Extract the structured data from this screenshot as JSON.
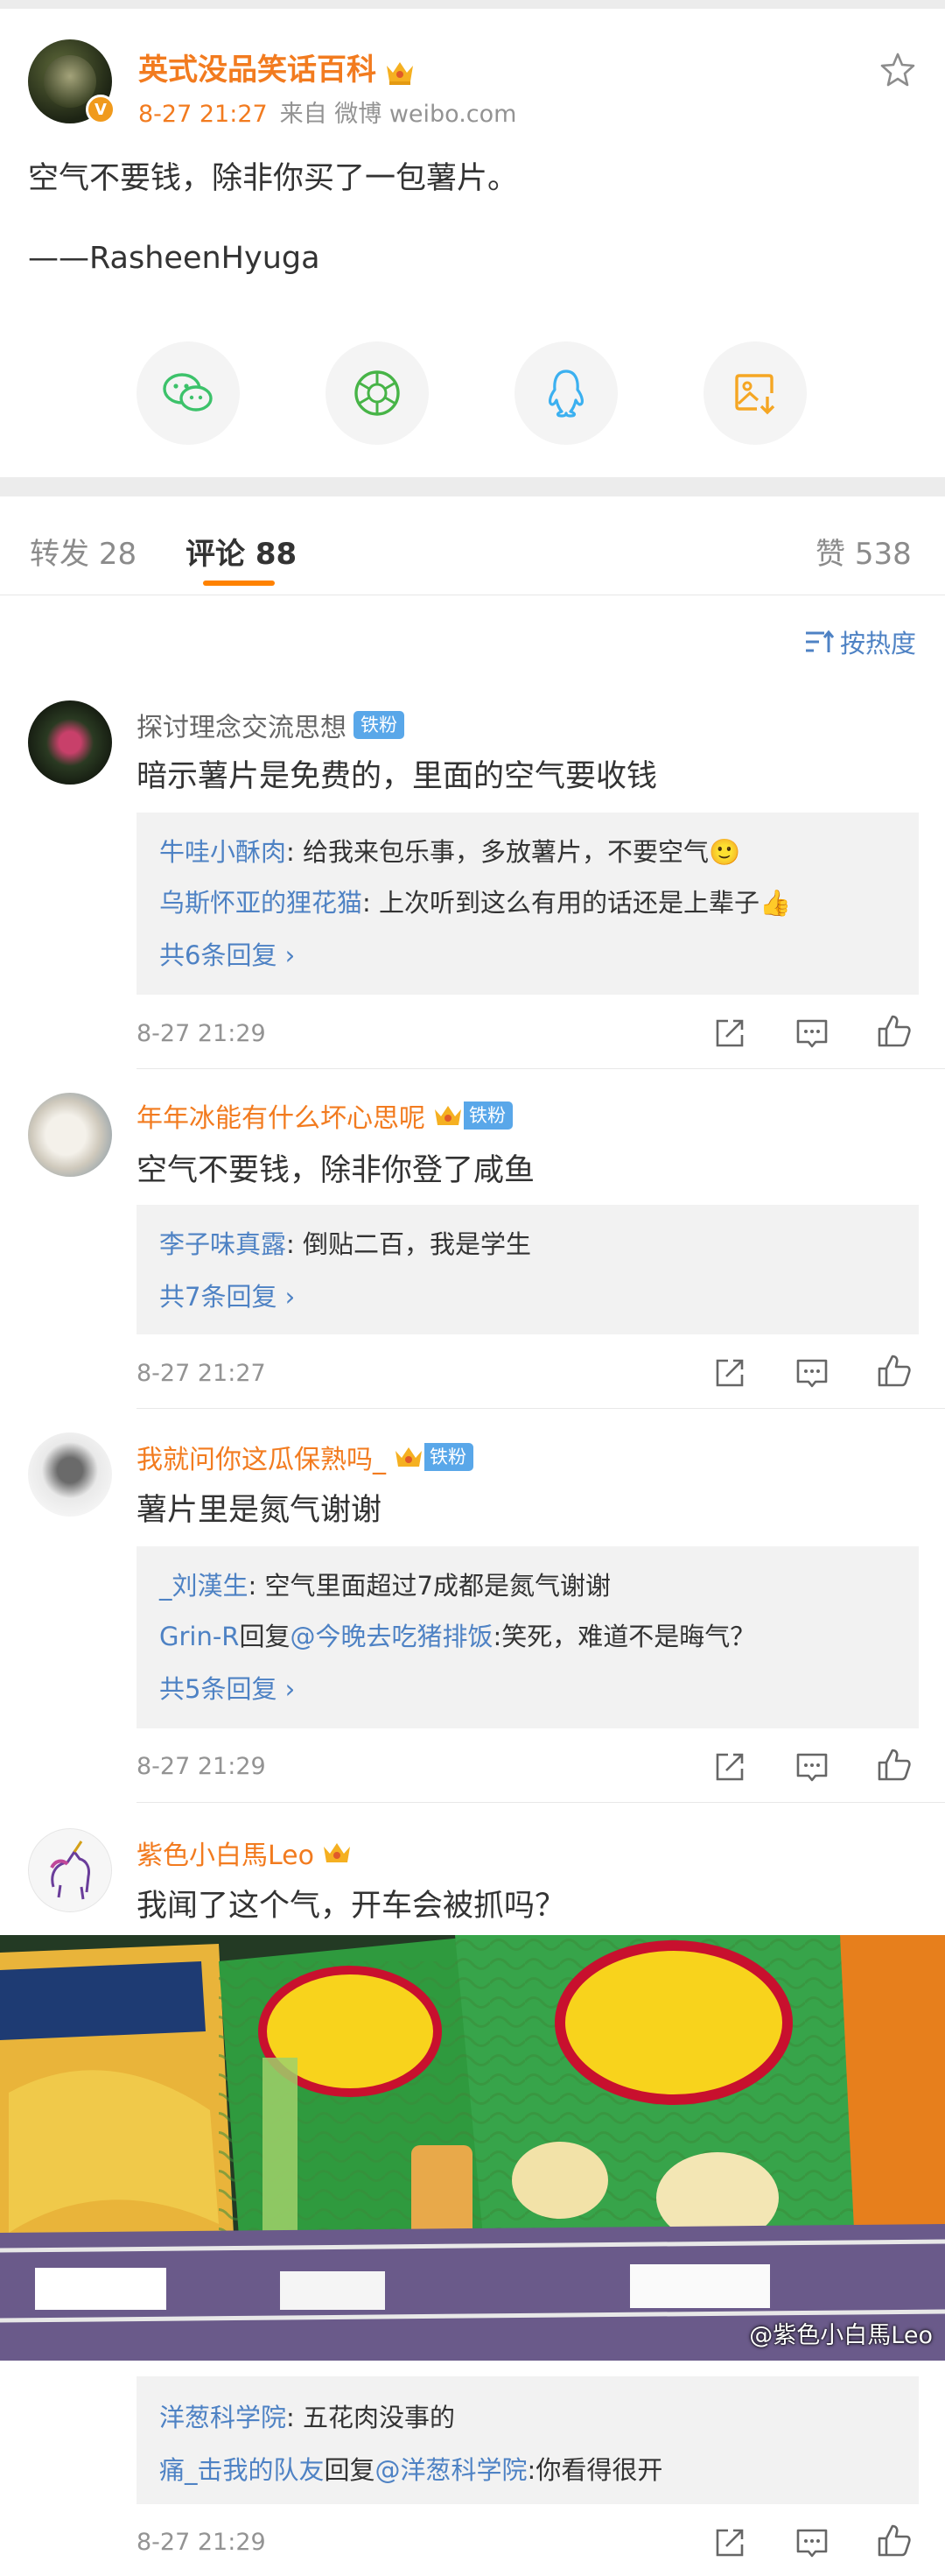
{
  "post": {
    "author": "英式没品笑话百科",
    "time": "8-27 21:27",
    "source": "来自 微博 weibo.com",
    "text": "空气不要钱，除非你买了一包薯片。",
    "attribution": "——RasheenHyuga",
    "verified_badge": "V",
    "share_icons": [
      "wechat-icon",
      "moments-icon",
      "qq-icon",
      "save-image-icon"
    ],
    "colors": {
      "name": "#f27b1f",
      "wechat": "#3cc26a",
      "moments": "#47b447",
      "qq": "#3bb0f0",
      "save": "#f5a623"
    }
  },
  "tabs": {
    "repost_label": "转发",
    "repost_count": "28",
    "comment_label": "评论",
    "comment_count": "88",
    "like_label": "赞",
    "like_count": "538"
  },
  "sort_label": "按热度",
  "comments": [
    {
      "name": "探讨理念交流思想",
      "badge": "铁粉",
      "text": "暗示薯片是免费的，里面的空气要收钱",
      "replies": [
        {
          "user": "牛哇小酥肉",
          "text": ": 给我来包乐事，多放薯片，不要空气🙂"
        },
        {
          "user": "乌斯怀亚的狸花猫",
          "text": ": 上次听到这么有用的话还是上辈子👍"
        }
      ],
      "more": "共6条回复 ›",
      "time": "8-27 21:29"
    },
    {
      "name": "年年冰能有什么坏心思呢",
      "badge": "铁粉",
      "text": "空气不要钱，除非你登了咸鱼",
      "replies": [
        {
          "user": "李子味真露",
          "text": ": 倒贴二百，我是学生"
        }
      ],
      "more": "共7条回复 ›",
      "time": "8-27 21:27"
    },
    {
      "name": "我就问你这瓜保熟吗_",
      "badge": "铁粉",
      "text": "薯片里是氮气谢谢",
      "replies": [
        {
          "user": "_刘漢生",
          "text": ": 空气里面超过7成都是氮气谢谢"
        },
        {
          "user": "Grin-R",
          "mid": "回复",
          "user2": "@今晚去吃猪排饭",
          "text": ":笑死，难道不是晦气？"
        }
      ],
      "more": "共5条回复 ›",
      "time": "8-27 21:29"
    },
    {
      "name": "紫色小白馬Leo",
      "text": "我闻了这个气，开车会被抓吗？",
      "image_watermark": "@紫色小白馬Leo",
      "replies": [
        {
          "user": "洋葱科学院",
          "text": ": 五花肉没事的"
        },
        {
          "user": "痛_击我的队友",
          "mid": "回复",
          "user2": "@洋葱科学院",
          "text": ":你看得很开"
        }
      ],
      "time": "8-27 21:29"
    }
  ]
}
